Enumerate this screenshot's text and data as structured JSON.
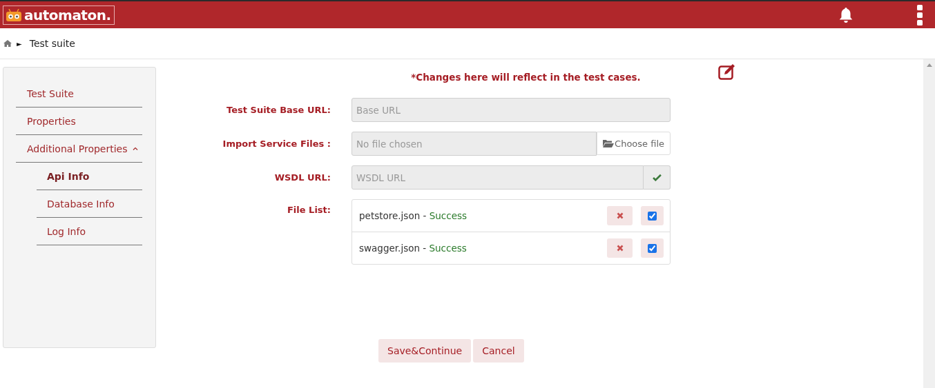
{
  "header": {
    "logo": "automaton."
  },
  "breadcrumb": {
    "separator": "►",
    "current": "Test suite"
  },
  "sidebar": {
    "items": [
      {
        "label": "Test Suite",
        "selected": false
      },
      {
        "label": "Properties",
        "selected": false
      },
      {
        "label": "Additional Properties",
        "selected": false,
        "expanded": true,
        "children": [
          {
            "label": "Api Info",
            "selected": true
          },
          {
            "label": "Database Info",
            "selected": false
          },
          {
            "label": "Log Info",
            "selected": false
          }
        ]
      }
    ]
  },
  "form": {
    "notice": "*Changes here will reflect in the test cases.",
    "fields": [
      {
        "kind": "text",
        "label": "Test Suite Base URL:",
        "placeholder": "Base URL"
      },
      {
        "kind": "file",
        "label": "Import Service Files :",
        "placeholder": "No file chosen",
        "button": "Choose file"
      },
      {
        "kind": "verify",
        "label": "WSDL URL:",
        "placeholder": "WSDL URL"
      }
    ],
    "file_list": {
      "label": "File List:",
      "files": [
        {
          "name": "petstore.json",
          "separator": "-",
          "status": "Success",
          "checked": true
        },
        {
          "name": "swagger.json",
          "separator": "-",
          "status": "Success",
          "checked": true
        }
      ]
    },
    "buttons": [
      "Save&Continue",
      "Cancel"
    ]
  }
}
